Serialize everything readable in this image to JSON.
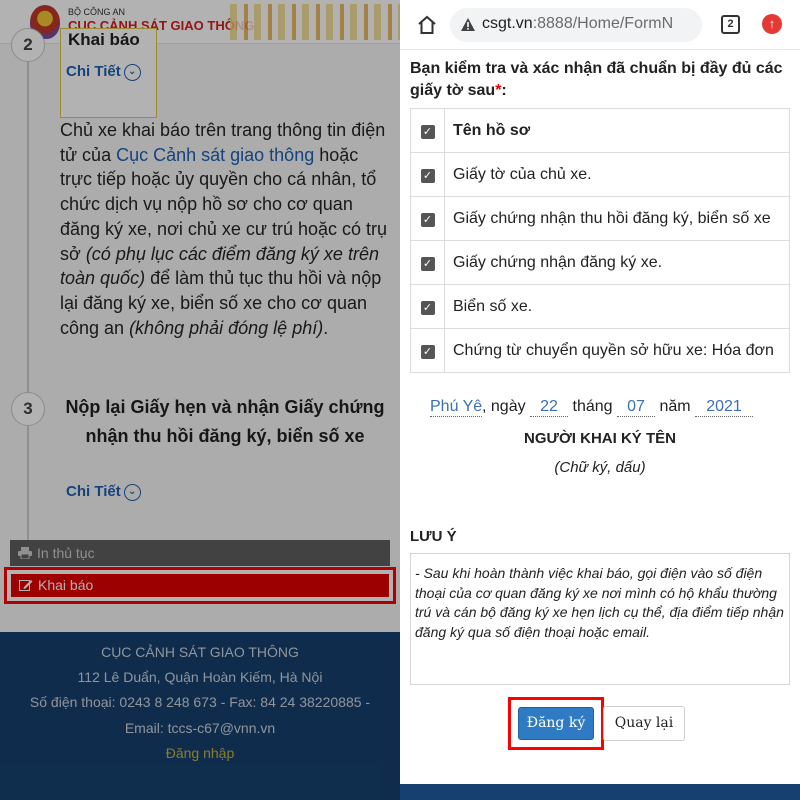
{
  "left": {
    "header": {
      "ministry": "BỘ CÔNG AN",
      "agency": "CỤC CẢNH SÁT GIAO THÔNG"
    },
    "step2": {
      "number": "2",
      "title": "Khai báo",
      "detail": "Chi Tiết"
    },
    "description": {
      "p1": "Chủ xe khai báo trên trang thông tin điện tử của ",
      "link": "Cục Cảnh sát giao thông",
      "p2": " hoặc trực tiếp hoặc ủy quyền cho cá nhân, tổ chức dịch vụ nộp hồ sơ cho cơ quan đăng ký xe, nơi chủ xe cư trú hoặc có trụ sở ",
      "em1": "(có phụ lục các điểm đăng ký xe trên toàn quốc)",
      "p3": " để làm thủ tục thu hồi và nộp lại đăng ký xe, biển số xe cho cơ quan công an ",
      "em2": "(không phải đóng lệ phí)",
      "p4": "."
    },
    "step3": {
      "number": "3",
      "title": "Nộp lại Giấy hẹn và nhận Giấy chứng nhận thu hồi đăng ký, biển số xe",
      "detail": "Chi Tiết"
    },
    "buttons": {
      "print": "In thủ tục",
      "declare": "Khai báo"
    },
    "footer": {
      "name": "CỤC CẢNH SÁT GIAO THÔNG",
      "address": "112 Lê Duẩn, Quận Hoàn Kiếm, Hà Nội",
      "phone": "Số điện thoại: 0243 8 248 673 - Fax: 84 24 38220885 -",
      "email": "Email: tccs-c67@vnn.vn",
      "login": "Đăng nhập"
    }
  },
  "browser": {
    "url_host": "csgt.vn",
    "url_rest": ":8888/Home/FormN",
    "tab_count": "2",
    "update_badge": "↑"
  },
  "form": {
    "heading": "Bạn kiểm tra và xác nhận đã chuẩn bị đầy đủ các giấy tờ sau",
    "required_mark": "*",
    "heading_colon": ":",
    "table_header": "Tên hồ sơ",
    "documents": [
      "Giấy tờ của chủ xe.",
      "Giấy chứng nhận thu hồi đăng ký, biển số xe",
      "Giấy chứng nhận đăng ký xe.",
      "Biển số xe.",
      "Chứng từ chuyển quyền sở hữu xe: Hóa đơn"
    ],
    "date": {
      "place": "Phú Yê",
      "day_label": ", ngày",
      "day": "22",
      "month_label": "tháng",
      "month": "07",
      "year_label": "năm",
      "year": "2021"
    },
    "signer": "NGƯỜI KHAI KÝ TÊN",
    "signer_note": "(Chữ ký, dấu)",
    "note_title": "LƯU Ý",
    "note_text": "- Sau khi hoàn thành việc khai báo, gọi điện vào số điện thoại của cơ quan đăng ký xe nơi mình có hộ khẩu thường trú và cán bộ đăng ký xe hẹn lịch cụ thể, địa điểm tiếp nhận đăng ký qua số điện thoại hoặc email.",
    "submit": "Đăng ký",
    "back": "Quay lại"
  },
  "colors": {
    "accent_red": "#e10000",
    "link_blue": "#1e60b3",
    "footer_navy": "#16406f",
    "submit_blue": "#2f7bc3"
  }
}
